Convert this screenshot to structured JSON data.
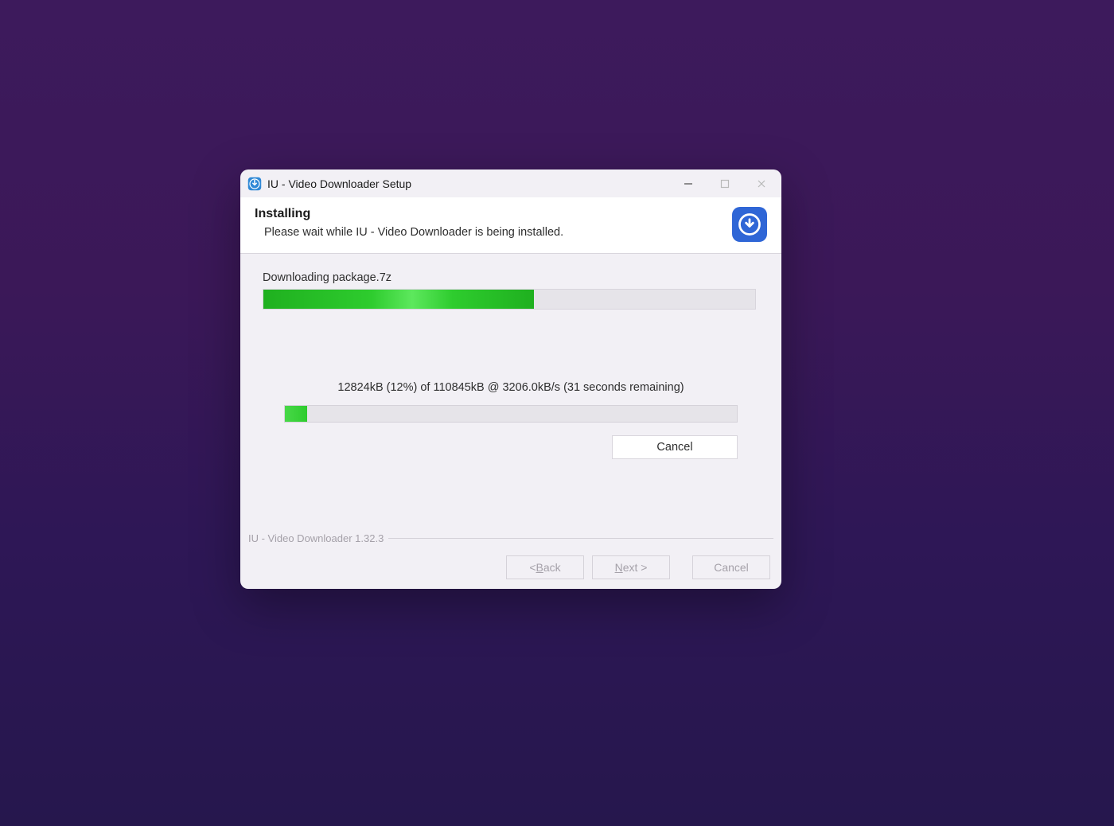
{
  "window": {
    "title": "IU - Video Downloader Setup"
  },
  "header": {
    "title": "Installing",
    "subtitle": "Please wait while IU - Video Downloader is being installed."
  },
  "task": {
    "label": "Downloading package.7z",
    "overall_percent": 55
  },
  "download": {
    "stats_text": "12824kB (12%) of 110845kB @ 3206.0kB/s (31 seconds remaining)",
    "percent": 5,
    "cancel_label": "Cancel"
  },
  "footer": {
    "product": "IU - Video Downloader 1.32.3",
    "back_prefix": "< ",
    "back_mn": "B",
    "back_suffix": "ack",
    "next_mn": "N",
    "next_suffix": "ext >",
    "cancel_label": "Cancel"
  }
}
